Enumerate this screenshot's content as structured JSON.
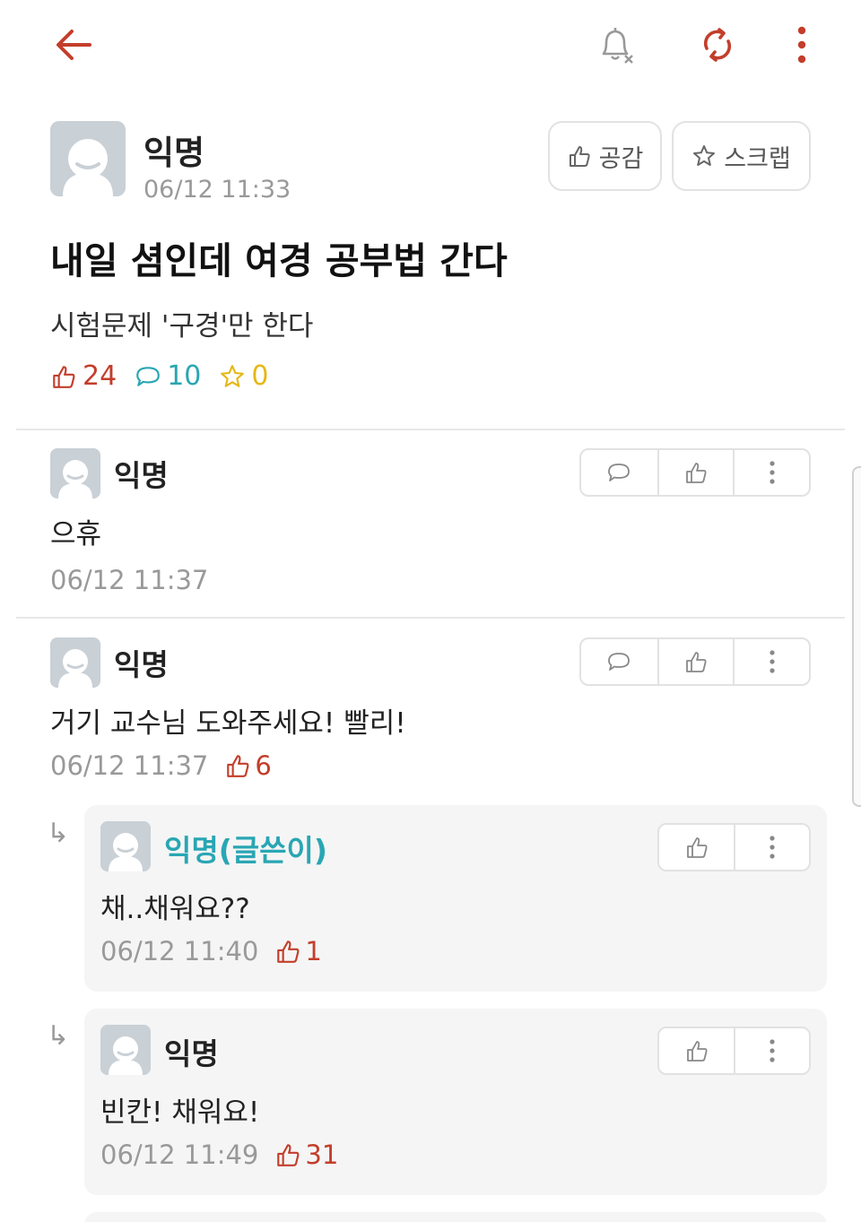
{
  "topbar": {
    "back_icon": "arrow-left-icon",
    "bell_icon": "bell-off-icon",
    "refresh_icon": "refresh-icon",
    "more_icon": "vertical-dots-icon"
  },
  "post": {
    "author": "익명",
    "time": "06/12 11:33",
    "like_button_label": "공감",
    "scrap_button_label": "스크랩",
    "title": "내일 셤인데 여경 공부법 간다",
    "body": "시험문제 '구경'만 한다",
    "stats": {
      "likes": "24",
      "comments": "10",
      "scraps": "0"
    }
  },
  "comments": [
    {
      "author": "익명",
      "text": "으휴",
      "time": "06/12 11:37",
      "likes": ""
    },
    {
      "author": "익명",
      "text": "거기 교수님 도와주세요! 빨리!",
      "time": "06/12 11:37",
      "likes": "6"
    }
  ],
  "replies": [
    {
      "author": "익명(글쓴이)",
      "text": "채..채워요??",
      "time": "06/12 11:40",
      "likes": "1"
    },
    {
      "author": "익명",
      "text": "빈칸! 채워요!",
      "time": "06/12 11:49",
      "likes": "31"
    }
  ],
  "reply_arrow": "↳",
  "colors": {
    "accent_red": "#c33e2b",
    "comment_teal": "#29a6b3",
    "scrap_yellow": "#e4b816",
    "meta_gray": "#999999",
    "avatar_gray": "#c9d0d6"
  }
}
